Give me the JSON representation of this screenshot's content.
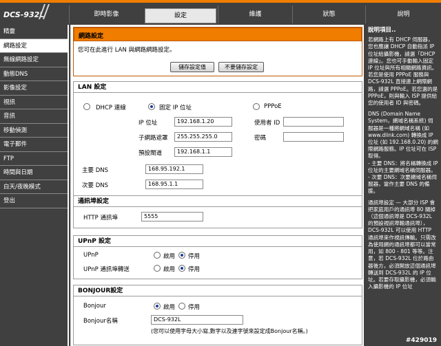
{
  "brand": {
    "model": "DCS-932L"
  },
  "tabs": [
    "即時影像",
    "設定",
    "維護",
    "狀態",
    "說明"
  ],
  "sidebar": {
    "items": [
      "精靈",
      "網路設定",
      "無線網路設定",
      "動態DNS",
      "影像設定",
      "視訊",
      "音訊",
      "移動偵測",
      "電子郵件",
      "FTP",
      "時間與日期",
      "白天/夜晚模式",
      "登出"
    ]
  },
  "network": {
    "title": "網路設定",
    "desc": "您可在此進行 LAN 與網路網路設定。",
    "save_label": "儲存設定值",
    "nosave_label": "不要儲存設定"
  },
  "lan": {
    "title": "LAN 設定",
    "dhcp_label": "DHCP 連線",
    "static_label": "固定 IP 位址",
    "pppoe_label": "PPPoE",
    "ip_label": "IP 位址",
    "ip_value": "192.168.1.20",
    "mask_label": "子網路遮罩",
    "mask_value": "255.255.255.0",
    "gateway_label": "預設閘道",
    "gateway_value": "192.168.1.1",
    "user_label": "使用者 ID",
    "pass_label": "密碼",
    "dns1_label": "主要 DNS",
    "dns1_value": "168.95.192.1",
    "dns2_label": "次要 DNS",
    "dns2_value": "168.95.1.1"
  },
  "port": {
    "title": "通訊埠設定",
    "http_label": "HTTP 通訊埠",
    "http_value": "5555"
  },
  "upnp": {
    "title": "UPnP 設定",
    "upnp_label": "UPnP",
    "forward_label": "UPnP 通訊埠轉送",
    "enable_label": "啟用",
    "disable_label": "停用"
  },
  "bonjour": {
    "title": "BONJOUR設定",
    "bonjour_label": "Bonjour",
    "name_label": "Bonjour名稱",
    "name_value": "DCS-932L",
    "enable_label": "啟用",
    "disable_label": "停用",
    "note": "(您可以使用字母大小寫,數字以及連字號來設定成Bonjour名稱。)"
  },
  "help": {
    "title": "說明項目..",
    "p1": "若網路上有 DHCP 伺服器，您也應讓 DHCP 自動指派 IP 位址給攝影機，請選「DHCP 連線」。您也可手動輸入固定 IP 位址與所有相關網路資訊。若您是使用 PPPoE 服務與 DCS-932L 直接連上網際網路，請選 PPPoE。若您選的是 PPPoE，則與輸入 ISP 提供給您的使用者 ID 與密碼。",
    "p2": "DNS (Domain Name System，網域名稱系統) 伺服器是一種將網域名稱 (如 www.dlink.com) 轉換成 IP 位址 (如 192.168.0.20) 的網際網路服務。IP 位址可在 ISP 取得。",
    "p3": "- 主要 DNS：將名稱轉換成 IP 位址的主要網域名稱伺服器。",
    "p4": "- 次要 DNS：次要網域名稱伺服器，當作主要 DNS 的備援。",
    "p5": "通訊埠設定 — 大部分 ISP 會把家庭用戶的通訊埠 80 關掉（這個通訊埠是 DCS-932L 的預設視訊埠輸通訊埠），DCS-932L 可以使用 HTTP 通訊埠來作視訊傳輸。只需改為使用網的通訊埠都可以當常用，如 800 - 801 等等。注意，若 DCS-932L 位於路由器後方，必須開放這個通訊埠轉送到 DCS-932L 的 IP 位址。若要存取攝影機，必須輸入攝影機的 IP 位址"
  },
  "watermark": "#429019"
}
